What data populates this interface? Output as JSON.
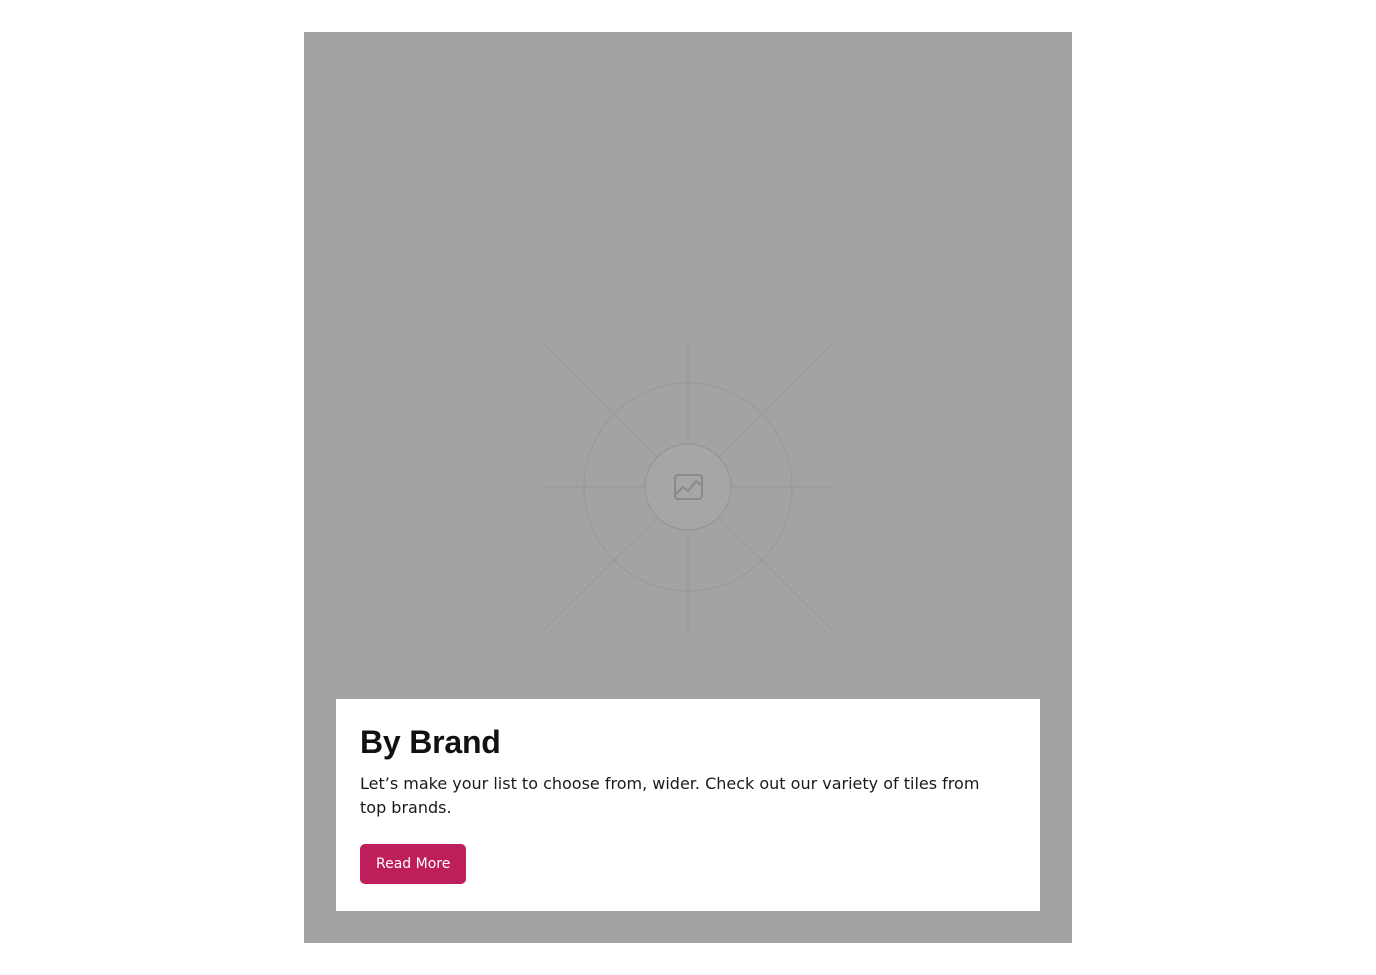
{
  "card": {
    "background_color": "#a3a3a3",
    "image_icon": "image-placeholder-icon",
    "title": "By Brand",
    "description": "Let’s make your list to choose from, wider. Check out our variety of tiles from top brands.",
    "button_label": "Read More",
    "button_color": "#be1e5a"
  }
}
